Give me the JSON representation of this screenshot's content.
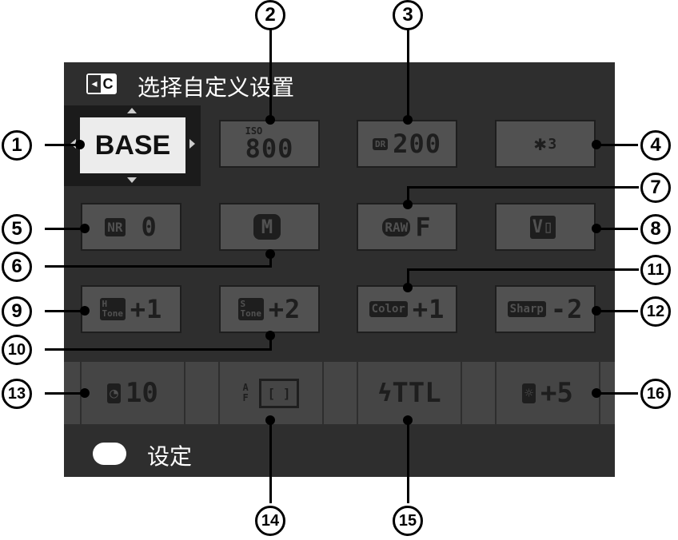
{
  "title": {
    "icon": "custom-c-icon",
    "label": "C",
    "text": "选择自定义设置"
  },
  "base": {
    "label": "BASE"
  },
  "tiles": {
    "iso": {
      "top": "ISO",
      "value": "800"
    },
    "dr": {
      "top": "DR",
      "value": "200"
    },
    "wb": {
      "value": "3"
    },
    "nr": {
      "badge": "NR",
      "value": "0"
    },
    "mode": {
      "value": "M"
    },
    "raw": {
      "badge": "RAW",
      "value": "F"
    },
    "film": {
      "badge": "V"
    },
    "htone": {
      "badge": "H Tone",
      "value": "+1"
    },
    "stone": {
      "badge": "S Tone",
      "value": "+2"
    },
    "color": {
      "badge": "Color",
      "value": "+1"
    },
    "sharp": {
      "badge": "Sharp",
      "value": "-2"
    }
  },
  "bottom": {
    "timer": {
      "value": "10"
    },
    "af": {
      "label": "AF",
      "value": "[ ]"
    },
    "flash": {
      "value": "TTL"
    },
    "bright": {
      "value": "+5"
    }
  },
  "footer": {
    "text": "设定"
  },
  "callouts": [
    "1",
    "2",
    "3",
    "4",
    "5",
    "6",
    "7",
    "8",
    "9",
    "10",
    "11",
    "12",
    "13",
    "14",
    "15",
    "16"
  ]
}
